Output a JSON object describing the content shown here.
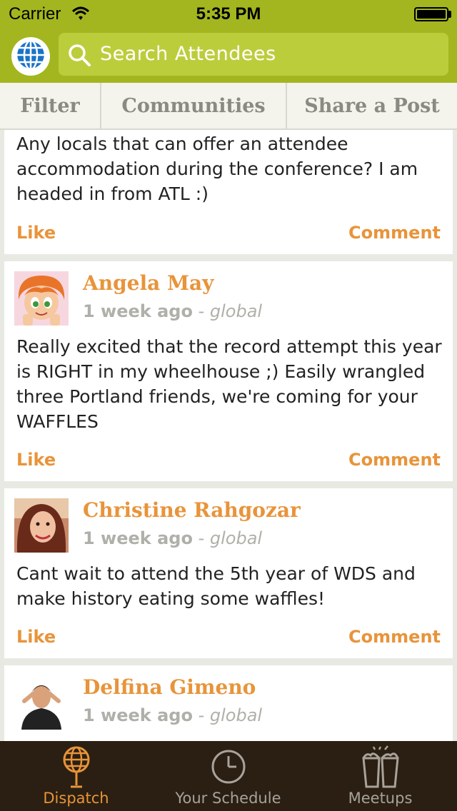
{
  "status_bar": {
    "carrier": "Carrier",
    "time": "5:35 PM"
  },
  "header": {
    "search_placeholder": "Search Attendees",
    "globe_icon": "globe-icon"
  },
  "tabs": [
    {
      "label": "Filter"
    },
    {
      "label": "Communities"
    },
    {
      "label": "Share a Post"
    }
  ],
  "feed": {
    "posts": [
      {
        "text": "Any locals that can offer an attendee accommodation during the conference? I am headed in from ATL :)",
        "like": "Like",
        "comment": "Comment"
      },
      {
        "author": "Angela May",
        "time_ago": "1 week ago",
        "separator": " - ",
        "scope": "global",
        "text": "Really excited that the record attempt this year is RIGHT in my wheelhouse ;) Easily wrangled three Portland friends, we're coming for your WAFFLES",
        "like": "Like",
        "comment": "Comment"
      },
      {
        "author": "Christine Rahgozar",
        "time_ago": "1 week ago",
        "separator": " - ",
        "scope": "global",
        "text": "Cant wait to attend the 5th year of WDS and make history eating some waffles!",
        "like": "Like",
        "comment": "Comment"
      },
      {
        "author": "Delfina Gimeno",
        "time_ago": "1 week ago",
        "separator": " - ",
        "scope": "global"
      }
    ]
  },
  "tabbar": [
    {
      "label": "Dispatch",
      "icon": "dispatch-globe-icon",
      "active": true
    },
    {
      "label": "Your Schedule",
      "icon": "clock-icon",
      "active": false
    },
    {
      "label": "Meetups",
      "icon": "beer-glasses-icon",
      "active": false
    }
  ],
  "colors": {
    "header_green": "#a3b61f",
    "search_green": "#bccd3c",
    "accent_orange": "#e8943a",
    "tabbar_brown": "#2a1f12"
  }
}
